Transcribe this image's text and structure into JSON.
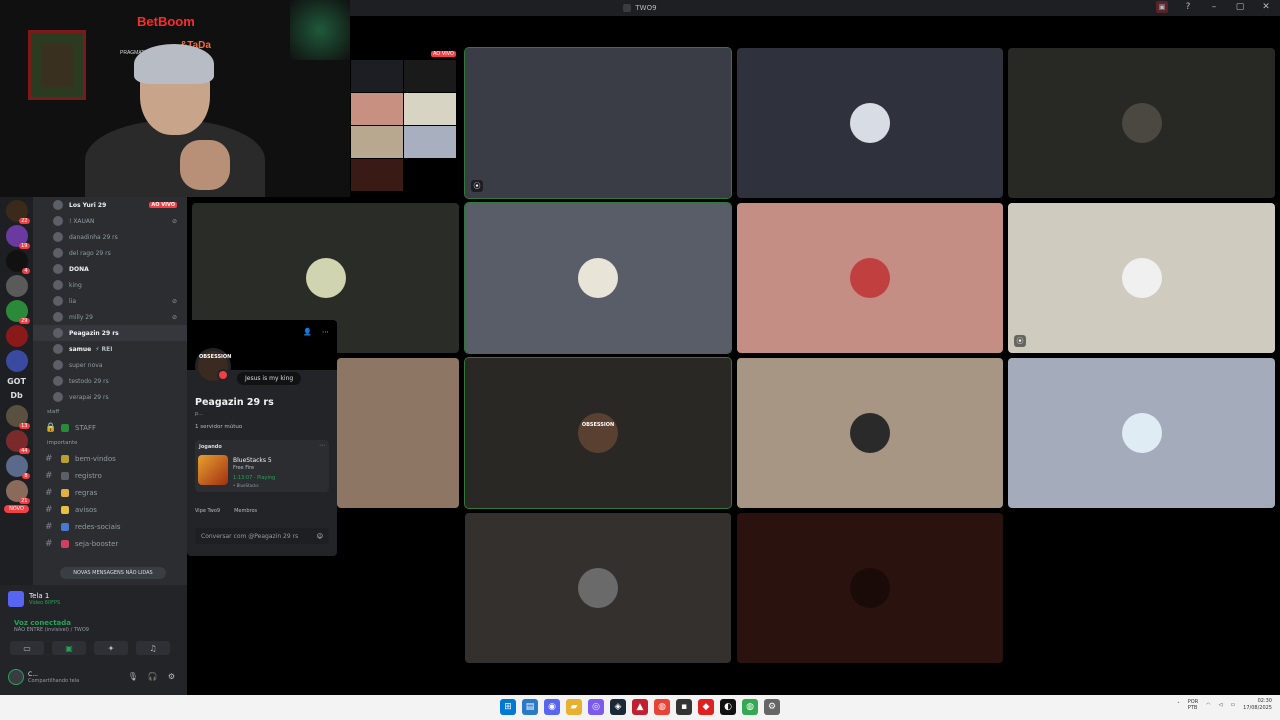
{
  "window": {
    "title": "TWO9"
  },
  "webcam": {
    "sign1": "BetBoom",
    "sign2": "&TaDa",
    "sign3": "PRAGMATIC P"
  },
  "servers": {
    "label_got": "GOT",
    "label_db": "Db",
    "badges": [
      "22",
      "19",
      "4",
      "29",
      "13",
      "44",
      "8",
      "21"
    ],
    "novo": "NOVO"
  },
  "voice_members": [
    {
      "name": "Los Yuri 29",
      "bright": true,
      "live": "AO VIVO"
    },
    {
      "name": "! XAUAN",
      "bright": false
    },
    {
      "name": "danadinha 29 rs",
      "bright": false
    },
    {
      "name": "del rago 29 rs",
      "bright": false
    },
    {
      "name": "DONA",
      "bright": true
    },
    {
      "name": "king",
      "bright": false
    },
    {
      "name": "lia",
      "bright": false
    },
    {
      "name": "milly 29",
      "bright": false
    },
    {
      "name": "Peagazin 29 rs",
      "bright": true,
      "highlight": true
    },
    {
      "name": "samue",
      "bright": true,
      "tag": "⚡ REI"
    },
    {
      "name": "super nova",
      "bright": false
    },
    {
      "name": "testodo 29 rs",
      "bright": false
    },
    {
      "name": "verapai 29 rs",
      "bright": false
    }
  ],
  "categories": {
    "staff": "staff",
    "importante": "importante"
  },
  "channels": {
    "staff": "STAFF",
    "list": [
      "bem-vindos",
      "registro",
      "regras",
      "avisos",
      "redes-sociais",
      "seja-booster"
    ]
  },
  "new_messages": "NOVAS MENSAGENS NÃO LIDAS",
  "stream": {
    "title": "Tela 1",
    "sub": "Vídeo 60FPS"
  },
  "voice": {
    "status": "Voz conectada",
    "channel": "NÃO ENTRE (invisível) / TWO9"
  },
  "me": {
    "name": "C...",
    "status": "Compartilhando tela"
  },
  "profile": {
    "bio_label": "OBSESSION",
    "status": "Jesus is my king",
    "name": "Peagazin 29 rs",
    "sub": "p...",
    "mutual": "1 servidor mútuo",
    "activity_label": "Jogando",
    "app": "BlueStacks 5",
    "game": "Free Fire",
    "time": "1:13:07",
    "state": "Playing",
    "small": "• BlueStacks",
    "tag1": "Vipe Two9",
    "tag2": "Membros",
    "message_placeholder": "Conversar com @Peagazin 29 rs"
  },
  "grid": {
    "live_tag": "AO VIVO",
    "obsession": "OBSESSION"
  },
  "tray": {
    "lang": "POR",
    "layout": "PTB",
    "time": "02:30",
    "date": "17/08/2025"
  },
  "colors": {
    "discord_green": "#23a559",
    "discord_red": "#f23f43",
    "blurple": "#5865f2"
  }
}
